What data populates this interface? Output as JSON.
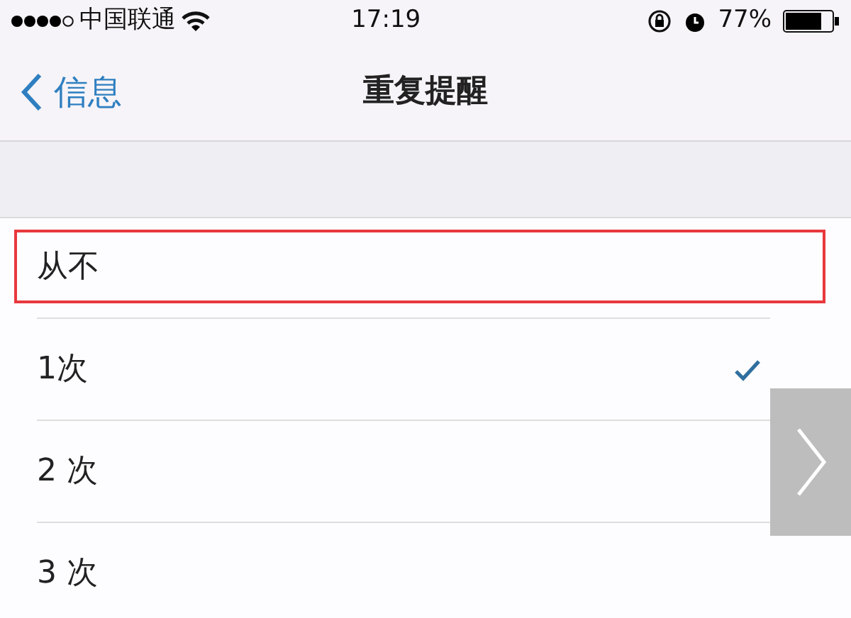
{
  "status_bar": {
    "carrier": "中国联通",
    "time": "17:19",
    "battery": "77%"
  },
  "nav": {
    "back": "信息",
    "title": "重复提醒"
  },
  "options": [
    {
      "label": "从不",
      "checked": false,
      "highlighted": true
    },
    {
      "label": "1次",
      "checked": true,
      "highlighted": false
    },
    {
      "label": "2 次",
      "checked": false,
      "highlighted": false
    },
    {
      "label": "3 次",
      "checked": false,
      "highlighted": false
    }
  ]
}
